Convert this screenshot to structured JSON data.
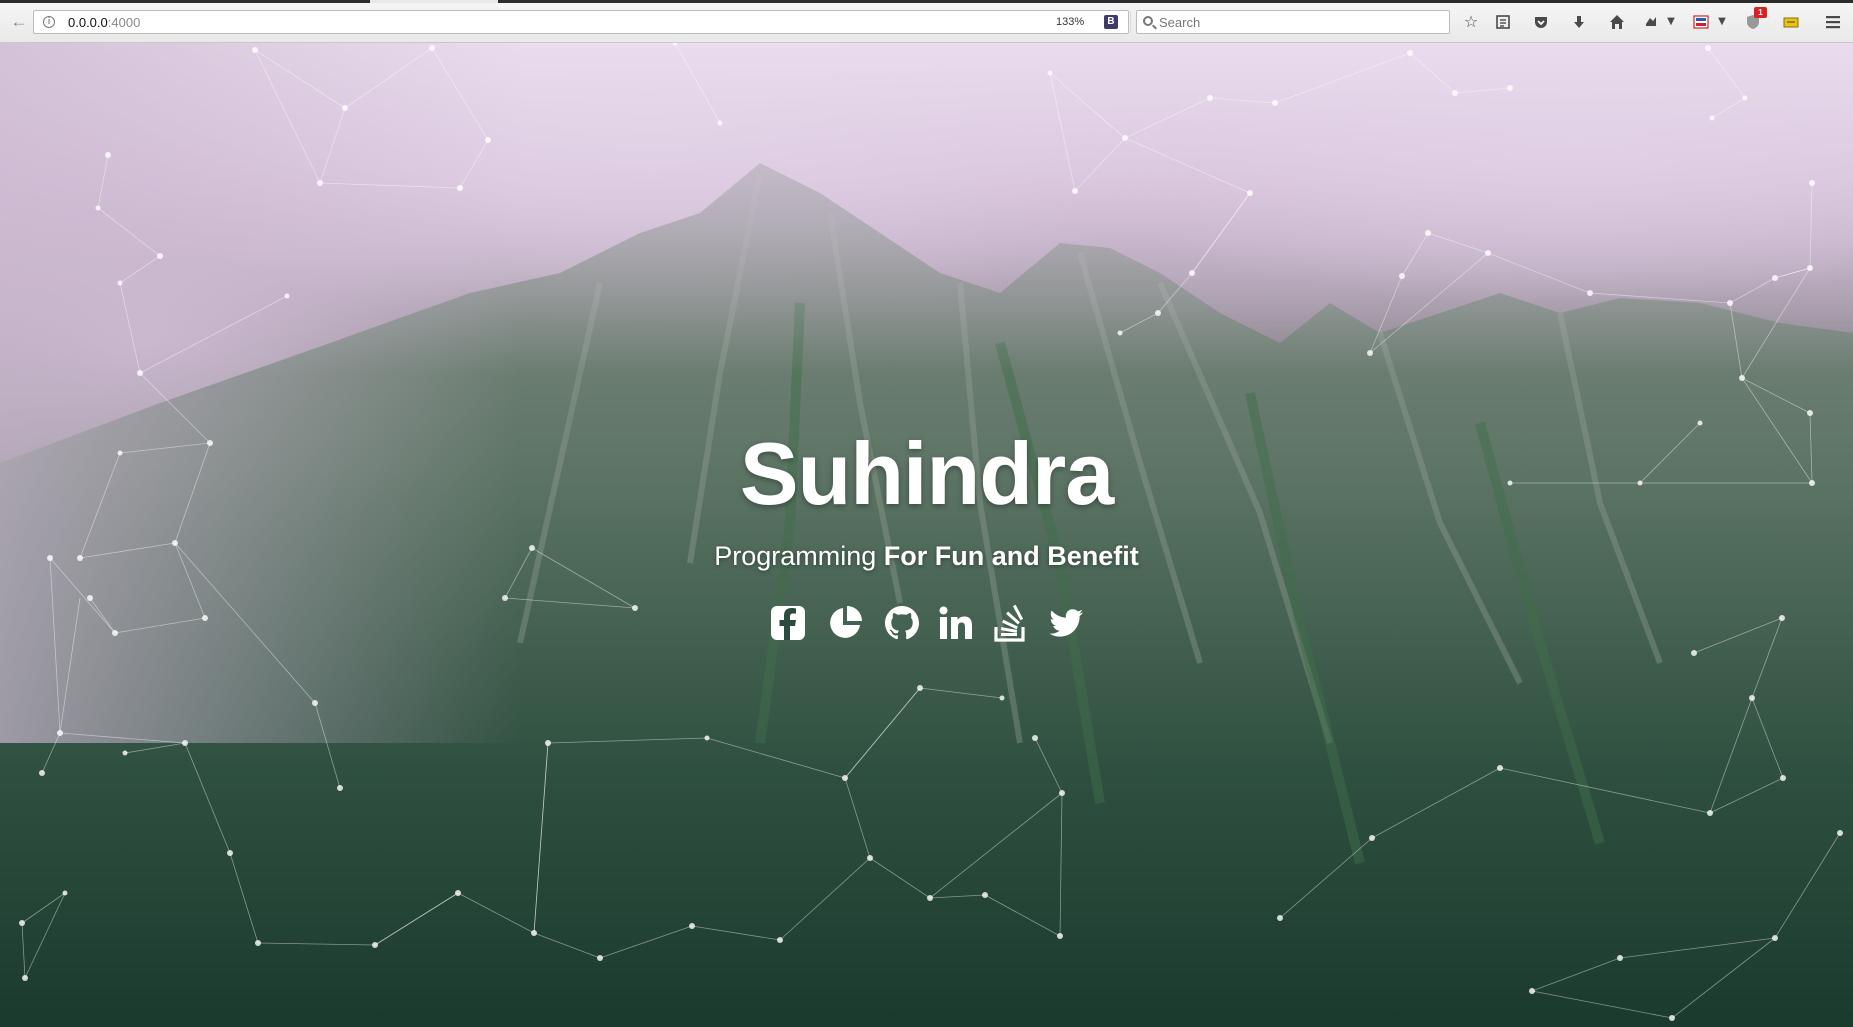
{
  "browser": {
    "url_host": "0.0.0.0",
    "url_port": ":4000",
    "zoom_level": "133%",
    "badge_letter": "B",
    "search_placeholder": "Search",
    "notification_count": "1",
    "icons": [
      "back-arrow-icon",
      "info-icon",
      "reload-icon",
      "search-icon",
      "bookmark-star-icon",
      "reading-list-icon",
      "pocket-icon",
      "downloads-icon",
      "home-icon",
      "extension-icon",
      "news-extension-icon",
      "shield-icon",
      "note-icon",
      "menu-icon"
    ]
  },
  "hero": {
    "title": "Suhindra",
    "tagline_light": "Programming ",
    "tagline_bold": "For Fun and Benefit",
    "socials": [
      {
        "name": "facebook",
        "icon": "facebook-icon"
      },
      {
        "name": "analytics",
        "icon": "pie-chart-icon"
      },
      {
        "name": "github",
        "icon": "github-icon"
      },
      {
        "name": "linkedin",
        "icon": "linkedin-icon"
      },
      {
        "name": "stackoverflow",
        "icon": "stackoverflow-icon"
      },
      {
        "name": "twitter",
        "icon": "twitter-icon"
      }
    ]
  },
  "colors": {
    "mist": "#e6d7ea",
    "forest": "#1c3a2f",
    "text": "#ffffff"
  }
}
